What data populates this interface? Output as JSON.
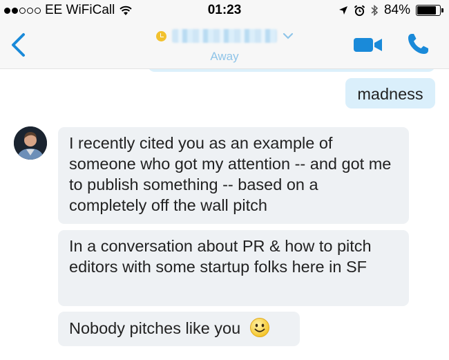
{
  "status_bar": {
    "carrier": "EE WiFiCall",
    "time": "01:23",
    "battery": "84%",
    "battery_level": 0.84,
    "signal_bars_filled": 2,
    "signal_bars_total": 5
  },
  "header": {
    "presence_status": "Away",
    "icons": [
      "back-icon",
      "presence-icon",
      "chevron-down-icon",
      "video-icon",
      "phone-icon"
    ],
    "colors": {
      "accent": "#1a8ad9",
      "presence": "#f2c12e",
      "status_text": "#8fc4e8"
    }
  },
  "messages": [
    {
      "direction": "outgoing",
      "text": "madness"
    },
    {
      "direction": "incoming",
      "text": "I recently  cited you as an example of someone who got my attention -- and got me to publish something -- based on a completely off the wall pitch"
    },
    {
      "direction": "incoming",
      "text": "In a conversation about PR & how to pitch editors with some startup folks here in SF"
    },
    {
      "direction": "incoming",
      "text": "Nobody pitches like you",
      "emoji": "smiley-icon"
    }
  ],
  "colors": {
    "outgoing_bubble": "#daeffb",
    "incoming_bubble": "#eef1f4"
  }
}
